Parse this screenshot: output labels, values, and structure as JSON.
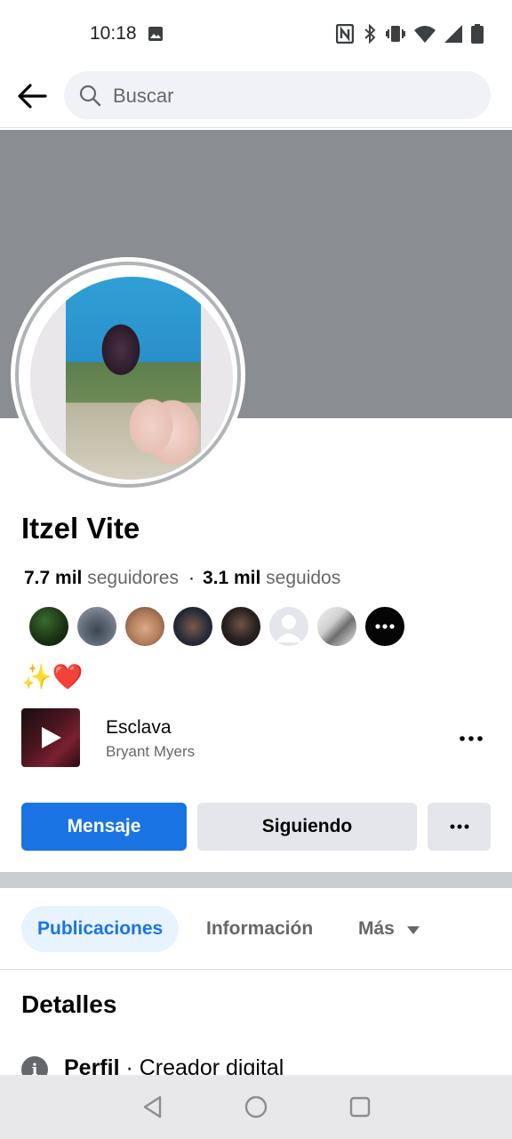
{
  "status_bar": {
    "time": "10:18",
    "icons": [
      "image-icon",
      "nfc-icon",
      "bluetooth-icon",
      "vibrate-icon",
      "wifi-icon",
      "signal-icon",
      "battery-icon"
    ]
  },
  "search": {
    "placeholder": "Buscar"
  },
  "profile": {
    "name": "Itzel Vite",
    "followers_count": "7.7 mil",
    "followers_label": "seguidores",
    "separator": "·",
    "following_count": "3.1 mil",
    "following_label": "seguidos",
    "bio": "✨❤️"
  },
  "music": {
    "title": "Esclava",
    "artist": "Bryant Myers"
  },
  "actions": {
    "message_label": "Mensaje",
    "following_label": "Siguiendo",
    "more_label": "•••"
  },
  "tabs": [
    {
      "label": "Publicaciones",
      "active": true
    },
    {
      "label": "Información",
      "active": false
    },
    {
      "label": "Más",
      "active": false
    }
  ],
  "details": {
    "title": "Detalles",
    "profile_label": "Perfil",
    "profile_separator": " · ",
    "profile_value": "Creador digital"
  },
  "colors": {
    "primary": "#1b74e4",
    "cover": "#8a8d91",
    "secondary_button": "#e4e6eb",
    "active_tab_bg": "#e7f3ff"
  }
}
